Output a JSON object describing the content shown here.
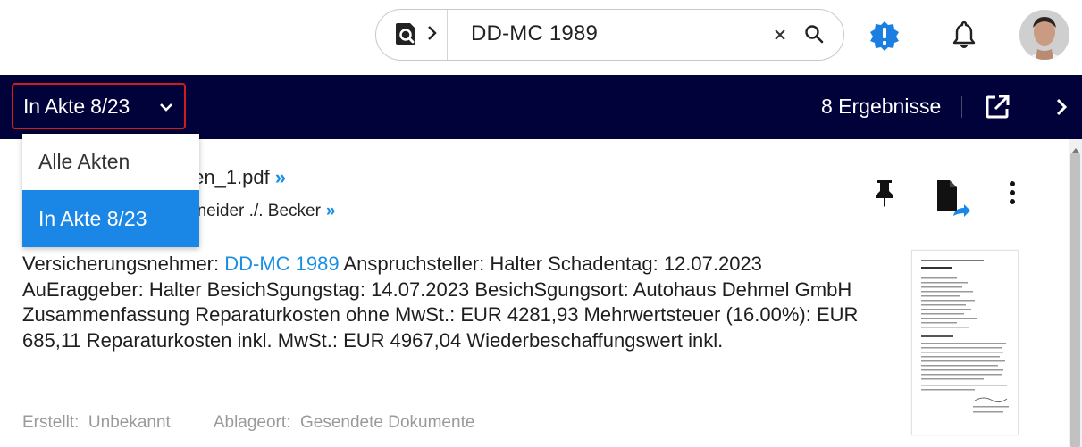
{
  "search": {
    "query": "DD-MC 1989"
  },
  "navbar": {
    "scope_label": "In Akte 8/23",
    "results": "8 Ergebnisse"
  },
  "dropdown": {
    "options": [
      "Alle Akten",
      "In Akte 8/23"
    ],
    "selected": "In Akte 8/23"
  },
  "result": {
    "filename_partial": "ten_1.pdf",
    "case_partial": "nneider ./. Becker",
    "link_glyph": "»",
    "snippet_prefix": "Versicherungsnehmer: ",
    "snippet_highlight": "DD-MC 1989",
    "snippet_rest": " Anspruchsteller: Halter Schadentag: 12.07.2023 AuEraggeber: Halter BesichSgungstag: 14.07.2023 BesichSgungsort: Autohaus Dehmel GmbH Zusammenfassung Reparaturkosten ohne MwSt.: EUR 4281,93 Mehrwertsteuer (16.00%): EUR 685,11 Reparaturkosten inkl. MwSt.: EUR 4967,04 Wiederbeschaffungswert inkl.",
    "created_label": "Erstellt:",
    "created_value": "Unbekannt",
    "location_label": "Ablageort:",
    "location_value": "Gesendete Dokumente"
  },
  "colors": {
    "navy": "#02023a",
    "accent_blue": "#1a87e6",
    "highlight_border": "#d21c1c"
  },
  "icons": [
    "search-scope-icon",
    "chevron-right-icon",
    "clear-icon",
    "search-icon",
    "alert-badge-icon",
    "bell-icon",
    "avatar",
    "chevron-down-icon",
    "open-external-icon",
    "chevron-right-icon",
    "pin-icon",
    "document-share-icon",
    "more-vert-icon"
  ]
}
